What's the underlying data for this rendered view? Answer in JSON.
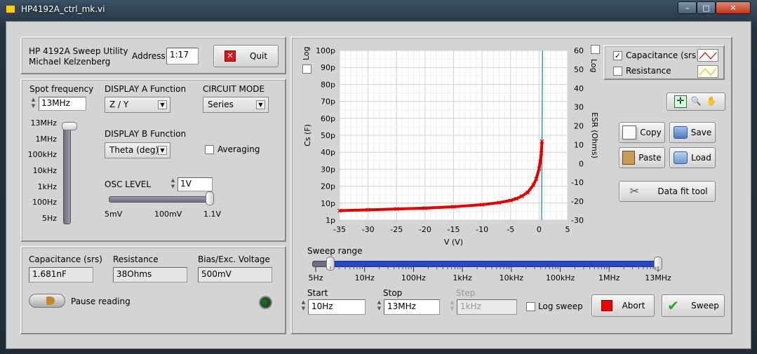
{
  "window": {
    "title": "HP4192A_ctrl_mk.vi",
    "min": "–",
    "max": "□",
    "close": "✕"
  },
  "header": {
    "app_name": "HP 4192A Sweep Utility",
    "author": "Michael Kelzenberg",
    "address_label": "Address",
    "address_value": "1:17",
    "quit_label": "Quit"
  },
  "spot": {
    "label": "Spot frequency",
    "value": "13MHz",
    "slider_ticks": [
      "13MHz",
      "1MHz",
      "100kHz",
      "10kHz",
      "1kHz",
      "100Hz",
      "5Hz"
    ],
    "slider_level": 1.0
  },
  "display_a": {
    "label": "DISPLAY A Function",
    "value": "Z / Y"
  },
  "display_b": {
    "label": "DISPLAY B Function",
    "value": "Theta (deg)"
  },
  "circuit": {
    "label": "CIRCUIT MODE",
    "value": "Series"
  },
  "averaging": {
    "label": "Averaging",
    "checked": false
  },
  "osc": {
    "label": "OSC LEVEL",
    "value": "1V",
    "ticks": [
      "5mV",
      "100mV",
      "1.1V"
    ],
    "level": 1.0
  },
  "readings": {
    "cap_label": "Capacitance (srs)",
    "cap_value": "1.681nF",
    "res_label": "Resistance",
    "res_value": "38Ohms",
    "bias_label": "Bias/Exc. Voltage",
    "bias_value": "500mV",
    "pause_label": "Pause reading"
  },
  "plot": {
    "log_left": "Log",
    "log_right": "Log",
    "legend": {
      "cap": "Capacitance (srs)",
      "res": "Resistance",
      "cap_checked": true,
      "res_checked": false
    }
  },
  "tools": {
    "copy": "Copy",
    "save": "Save",
    "paste": "Paste",
    "load": "Load",
    "datafit": "Data fit tool"
  },
  "sweep": {
    "range_label": "Sweep range",
    "range_ticks": [
      "5Hz",
      "10Hz",
      "100Hz",
      "1kHz",
      "10kHz",
      "100kHz",
      "1MHz",
      "13MHz"
    ],
    "start_label": "Start",
    "start_value": "10Hz",
    "stop_label": "Stop",
    "stop_value": "13MHz",
    "step_label": "Step",
    "step_value": "1kHz",
    "log_sweep_label": "Log sweep",
    "log_sweep_checked": false,
    "abort_label": "Abort",
    "sweep_label": "Sweep"
  },
  "colors": {
    "cap_series": "#e00000",
    "res_series": "#1f8a9a",
    "led": "#0f3a12",
    "range_fill": "#2448c8"
  },
  "chart_data": {
    "type": "scatter",
    "xlabel": "V (V)",
    "ylabel": "Cs (F)",
    "y2label": "ESR (Ohms)",
    "xlim": [
      -35,
      5
    ],
    "ylim": [
      1e-12,
      1e-10
    ],
    "y2lim": [
      -30,
      60
    ],
    "x_ticks": [
      "-35",
      "-30",
      "-25",
      "-20",
      "-15",
      "-10",
      "-5",
      "0",
      "5"
    ],
    "y_ticks": [
      "1p",
      "10p",
      "20p",
      "30p",
      "40p",
      "50p",
      "60p",
      "70p",
      "80p",
      "90p",
      "100p"
    ],
    "y2_ticks": [
      "-30",
      "-20",
      "-10",
      "0",
      "10",
      "20",
      "30",
      "40",
      "50",
      "60"
    ],
    "grid": true,
    "series": [
      {
        "name": "Capacitance (srs)",
        "x": [
          -35,
          -30,
          -25,
          -20,
          -15,
          -10,
          -7,
          -5,
          -4,
          -3,
          -2,
          -1,
          -0.5,
          0,
          0.2,
          0.4,
          0.5
        ],
        "y": [
          6.5e-12,
          7e-12,
          7.5e-12,
          8e-12,
          8.8e-12,
          1e-11,
          1.12e-11,
          1.25e-11,
          1.35e-11,
          1.5e-11,
          1.72e-11,
          2.15e-11,
          2.5e-11,
          3.1e-11,
          3.5e-11,
          4e-11,
          4.7e-11
        ]
      },
      {
        "name": "Resistance",
        "x": [
          0.45,
          0.5,
          0.55,
          0.6,
          0.6
        ],
        "y": [
          -30,
          5,
          30,
          55,
          60
        ]
      }
    ]
  }
}
